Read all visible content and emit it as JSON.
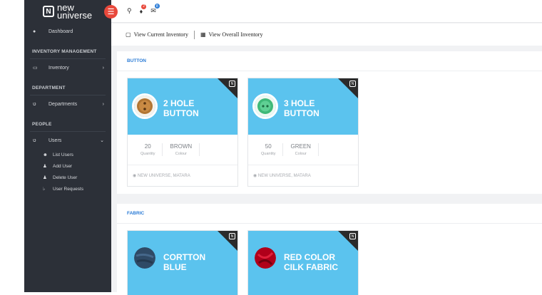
{
  "brand": {
    "line1": "new",
    "line2": "universe",
    "mark": "N"
  },
  "sidebar": {
    "dashboard": "Dashboard",
    "sections": {
      "inventory": "INVENTORY MANAGEMENT",
      "department": "DEPARTMENT",
      "people": "PEOPLE"
    },
    "inventory": "Inventory",
    "departments": "Departments",
    "users": "Users",
    "user_sub": [
      "List Users",
      "Add User",
      "Delete User",
      "User Requests"
    ]
  },
  "topbar": {
    "notif_count": "2",
    "mail_count": "8"
  },
  "subbar": {
    "view_current": "View  Current  Inventory",
    "view_overall": "View Overall Inventory"
  },
  "categories": [
    {
      "name": "BUTTON",
      "items": [
        {
          "title": "2 HOLE BUTTON",
          "quantity": "20",
          "quantity_label": "Quantity",
          "colour": "BROWN",
          "colour_label": "Colour",
          "location": "NEW UNIVERSE, MATARA"
        },
        {
          "title": "3 HOLE BUTTON",
          "quantity": "50",
          "quantity_label": "Quantity",
          "colour": "GREEN",
          "colour_label": "Colour",
          "location": "NEW UNIVERSE, MATARA"
        }
      ]
    },
    {
      "name": "FABRIC",
      "items": [
        {
          "title": "CORTTON BLUE"
        },
        {
          "title": "RED COLOR CILK FABRIC"
        }
      ]
    }
  ],
  "colors": {
    "sidebar": "#2c3038",
    "card_top": "#5bc3ee",
    "accent_blue": "#2a7bd6",
    "toggle_red": "#e8483b"
  }
}
